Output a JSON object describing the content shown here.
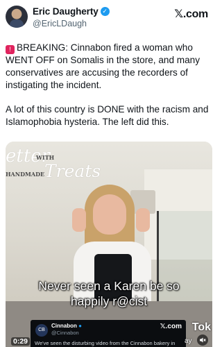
{
  "author": {
    "name": "Eric Daugherty",
    "handle": "@EricLDaugh",
    "verified": true
  },
  "brand": {
    "logo_text": "𝕏.com"
  },
  "tweet": {
    "paragraph1": "BREAKING: Cinnabon fired a woman who WENT OFF on Somalis in the store, and many conservatives are accusing the recorders of instigating the incident.",
    "paragraph2": "A lot of this country is DONE with the racism and Islamophobia hysteria. The left did this.",
    "siren_icon": "siren-icon"
  },
  "media": {
    "sign_line1": "etter",
    "sign_with": "WITH",
    "sign_line2": "HANDMADE",
    "sign_treats": "Treats",
    "caption_line1": "Never seen a Karen be so",
    "caption_line2": "happily r@cist",
    "watermark": "Tok",
    "timestamp": "0:29",
    "day_text": "ay",
    "mute_icon": "speaker-muted-icon"
  },
  "embedded_post": {
    "name": "Cinnabon",
    "handle": "@Cinnabon",
    "logo_text": "𝕏.com",
    "text": "We've seen the disturbing video from the Cinnabon bakery in"
  },
  "colors": {
    "accent": "#1d9bf0",
    "text": "#0f1419",
    "muted": "#536471"
  }
}
